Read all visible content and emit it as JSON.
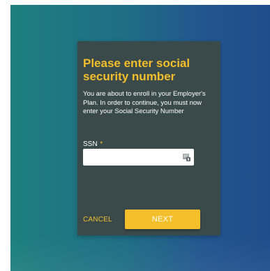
{
  "dialog": {
    "title": "Please enter social security number",
    "description": "You are about to enroll in your Employer's Plan. In order to continue, you must now enter your Social Security Number",
    "field": {
      "label": "SSN",
      "required_mark": "*",
      "value": "",
      "icon": "password-key-icon"
    },
    "cancel_label": "CANCEL",
    "next_label": "NEXT"
  },
  "colors": {
    "accent": "#f4bf2a",
    "dialog_bg": "#3a4a4a",
    "backdrop_start": "#1d7f7f",
    "backdrop_end": "#1f4d8c"
  }
}
